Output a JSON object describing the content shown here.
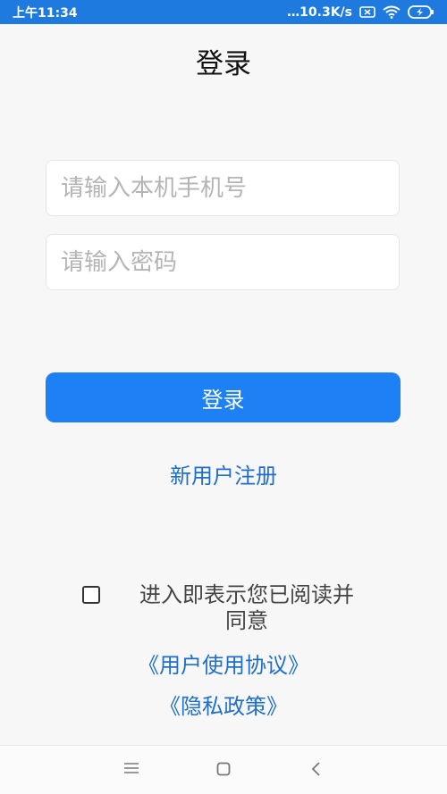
{
  "status_bar": {
    "time": "上午11:34",
    "network_speed": "…10.3K/s",
    "icons": [
      "sim-disabled-icon",
      "wifi-icon",
      "battery-charging-icon"
    ]
  },
  "page": {
    "title": "登录"
  },
  "form": {
    "phone_placeholder": "请输入本机手机号",
    "password_placeholder": "请输入密码",
    "login_button": "登录",
    "register_link": "新用户注册"
  },
  "agreement": {
    "text": "进入即表示您已阅读并同意",
    "user_agreement_link": "《用户使用协议》",
    "privacy_link": "《隐私政策》",
    "checked": false
  },
  "colors": {
    "status_bar": "#1f7ae0",
    "primary": "#1e80f5",
    "link": "#1f6fc8",
    "background": "#f7f7f7"
  },
  "nav_bar": {
    "icons": [
      "menu-icon",
      "home-icon",
      "back-icon"
    ]
  }
}
